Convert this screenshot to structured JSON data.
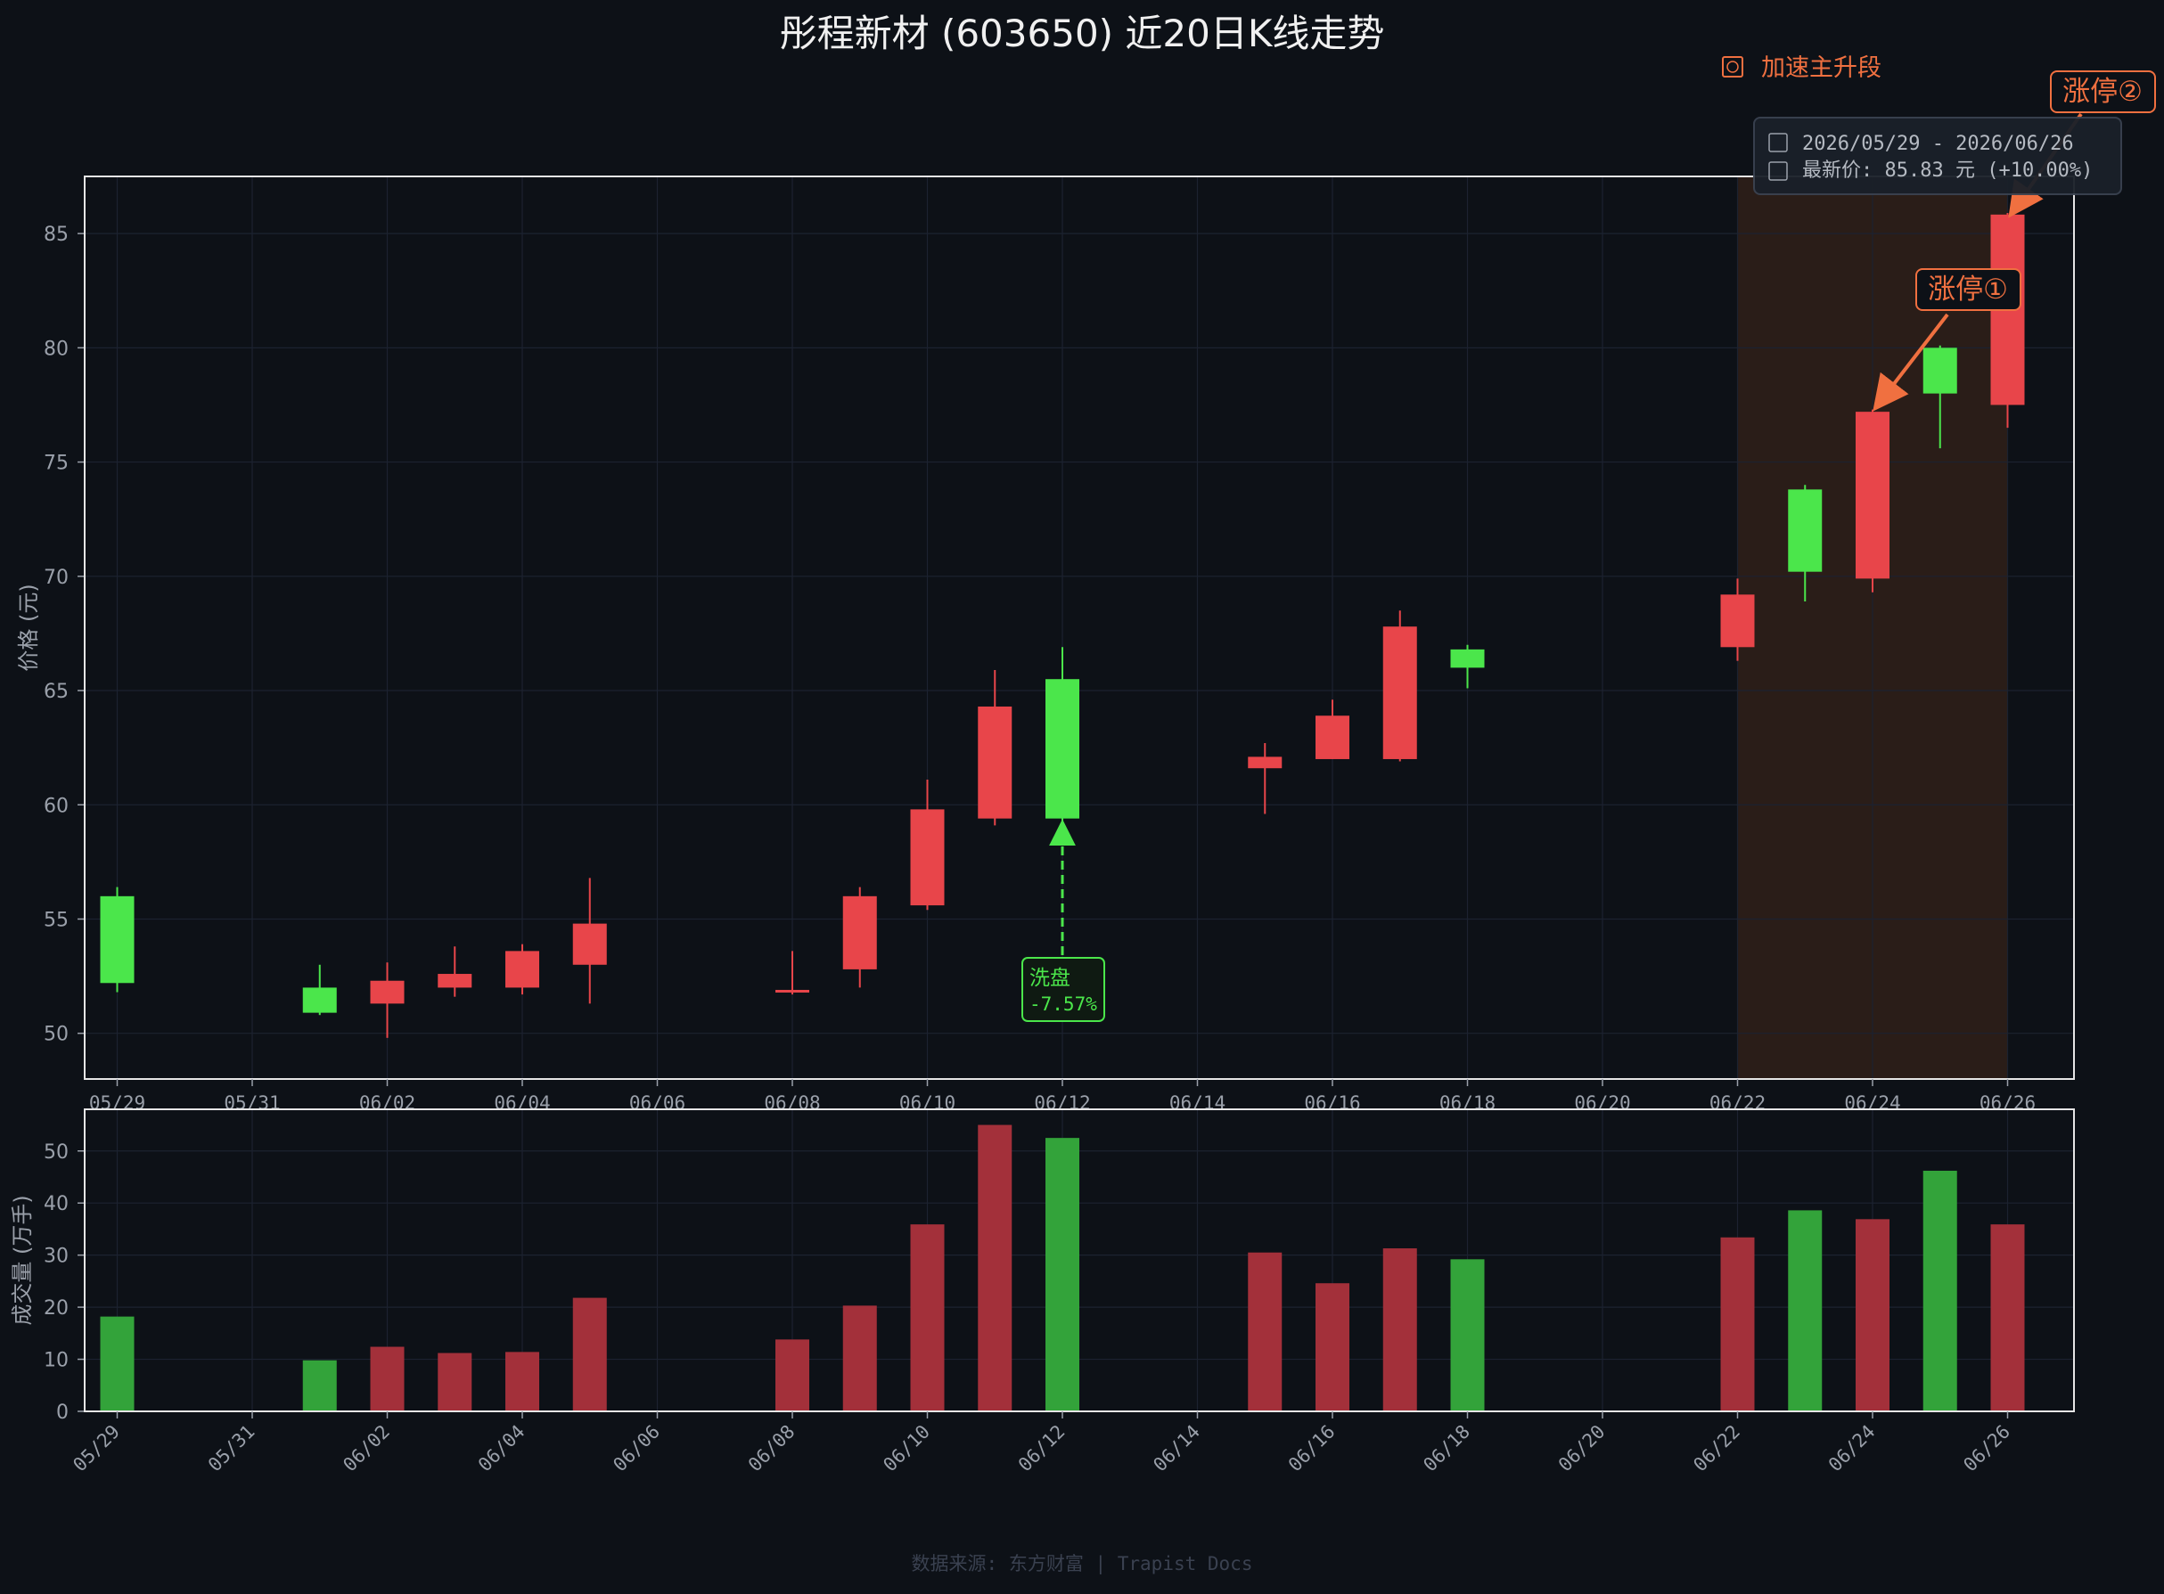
{
  "title": "彤程新材 (603650) 近20日K线走势",
  "footer": "数据来源: 东方财富  |  Trapist Docs",
  "colors": {
    "background": "#0d1117",
    "up": "#e8454a",
    "down": "#4be64b",
    "vol_up": "#a3303a",
    "vol_down": "#33a33a",
    "accent": "#f07040",
    "highlight": "#2a1d18"
  },
  "chart_data": [
    {
      "type": "candlestick",
      "ylabel": "价格 (元)",
      "ylim": [
        48,
        87.5
      ],
      "yticks": [
        50,
        55,
        60,
        65,
        70,
        75,
        80,
        85
      ],
      "grid": true,
      "xticks": [
        "05/29",
        "05/31",
        "06/02",
        "06/04",
        "06/06",
        "06/08",
        "06/10",
        "06/12",
        "06/14",
        "06/16",
        "06/18",
        "06/20",
        "06/22",
        "06/24",
        "06/26"
      ],
      "candles": [
        {
          "date": "2026-05-29",
          "day": 0,
          "open": 56.0,
          "close": 52.2,
          "high": 56.4,
          "low": 51.8
        },
        {
          "date": "2026-06-01",
          "day": 3,
          "open": 52.0,
          "close": 50.9,
          "high": 53.0,
          "low": 50.8
        },
        {
          "date": "2026-06-02",
          "day": 4,
          "open": 51.3,
          "close": 52.3,
          "high": 53.1,
          "low": 49.8
        },
        {
          "date": "2026-06-03",
          "day": 5,
          "open": 52.0,
          "close": 52.6,
          "high": 53.8,
          "low": 51.6
        },
        {
          "date": "2026-06-04",
          "day": 6,
          "open": 52.0,
          "close": 53.6,
          "high": 53.9,
          "low": 51.7
        },
        {
          "date": "2026-06-05",
          "day": 7,
          "open": 53.0,
          "close": 54.8,
          "high": 56.8,
          "low": 51.3
        },
        {
          "date": "2026-06-08",
          "day": 10,
          "open": 51.8,
          "close": 51.9,
          "high": 53.6,
          "low": 51.7
        },
        {
          "date": "2026-06-09",
          "day": 11,
          "open": 52.8,
          "close": 56.0,
          "high": 56.4,
          "low": 52.0
        },
        {
          "date": "2026-06-10",
          "day": 12,
          "open": 55.6,
          "close": 59.8,
          "high": 61.1,
          "low": 55.4
        },
        {
          "date": "2026-06-11",
          "day": 13,
          "open": 59.4,
          "close": 64.3,
          "high": 65.9,
          "low": 59.1
        },
        {
          "date": "2026-06-12",
          "day": 14,
          "open": 65.5,
          "close": 59.4,
          "high": 66.9,
          "low": 59.2
        },
        {
          "date": "2026-06-15",
          "day": 17,
          "open": 61.6,
          "close": 62.1,
          "high": 62.7,
          "low": 59.6
        },
        {
          "date": "2026-06-16",
          "day": 18,
          "open": 62.0,
          "close": 63.9,
          "high": 64.6,
          "low": 62.0
        },
        {
          "date": "2026-06-17",
          "day": 19,
          "open": 62.0,
          "close": 67.8,
          "high": 68.5,
          "low": 61.9
        },
        {
          "date": "2026-06-18",
          "day": 20,
          "open": 66.8,
          "close": 66.0,
          "high": 67.0,
          "low": 65.1
        },
        {
          "date": "2026-06-22",
          "day": 24,
          "open": 66.9,
          "close": 69.2,
          "high": 69.9,
          "low": 66.3
        },
        {
          "date": "2026-06-23",
          "day": 25,
          "open": 73.8,
          "close": 70.2,
          "high": 74.0,
          "low": 68.9
        },
        {
          "date": "2026-06-24",
          "day": 26,
          "open": 69.9,
          "close": 77.2,
          "high": 77.3,
          "low": 69.3
        },
        {
          "date": "2026-06-25",
          "day": 27,
          "open": 80.0,
          "close": 78.0,
          "high": 80.1,
          "low": 75.6
        },
        {
          "date": "2026-06-26",
          "day": 28,
          "open": 77.5,
          "close": 85.83,
          "high": 85.9,
          "low": 76.5
        }
      ],
      "highlight_range": {
        "from_day": 24,
        "to_day": 28,
        "label": "加速主升段"
      },
      "annotations": [
        {
          "label": "涨停①",
          "day": 26
        },
        {
          "label": "涨停②",
          "day": 28
        },
        {
          "label": "洗盘",
          "sub": "-7.57%",
          "day": 14
        }
      ],
      "info_box": {
        "range": "2026/05/29 - 2026/06/26",
        "latest": "最新价: 85.83 元  (+10.00%)"
      }
    },
    {
      "type": "bar",
      "ylabel": "成交量 (万手)",
      "ylim": [
        0,
        58
      ],
      "yticks": [
        0,
        10,
        20,
        30,
        40,
        50
      ],
      "grid": true,
      "xticks": [
        "05/29",
        "05/31",
        "06/02",
        "06/04",
        "06/06",
        "06/08",
        "06/10",
        "06/12",
        "06/14",
        "06/16",
        "06/18",
        "06/20",
        "06/22",
        "06/24",
        "06/26"
      ],
      "volumes": [
        {
          "day": 0,
          "value": 18.2,
          "dir": "down"
        },
        {
          "day": 3,
          "value": 9.8,
          "dir": "down"
        },
        {
          "day": 4,
          "value": 12.4,
          "dir": "up"
        },
        {
          "day": 5,
          "value": 11.2,
          "dir": "up"
        },
        {
          "day": 6,
          "value": 11.4,
          "dir": "up"
        },
        {
          "day": 7,
          "value": 21.8,
          "dir": "up"
        },
        {
          "day": 10,
          "value": 13.8,
          "dir": "up"
        },
        {
          "day": 11,
          "value": 20.3,
          "dir": "up"
        },
        {
          "day": 12,
          "value": 35.9,
          "dir": "up"
        },
        {
          "day": 13,
          "value": 55.0,
          "dir": "up"
        },
        {
          "day": 14,
          "value": 52.5,
          "dir": "down"
        },
        {
          "day": 17,
          "value": 30.5,
          "dir": "up"
        },
        {
          "day": 18,
          "value": 24.6,
          "dir": "up"
        },
        {
          "day": 19,
          "value": 31.3,
          "dir": "up"
        },
        {
          "day": 20,
          "value": 29.2,
          "dir": "down"
        },
        {
          "day": 24,
          "value": 33.4,
          "dir": "up"
        },
        {
          "day": 25,
          "value": 38.6,
          "dir": "down"
        },
        {
          "day": 26,
          "value": 36.9,
          "dir": "up"
        },
        {
          "day": 27,
          "value": 46.2,
          "dir": "down"
        },
        {
          "day": 28,
          "value": 35.9,
          "dir": "up"
        }
      ]
    }
  ]
}
